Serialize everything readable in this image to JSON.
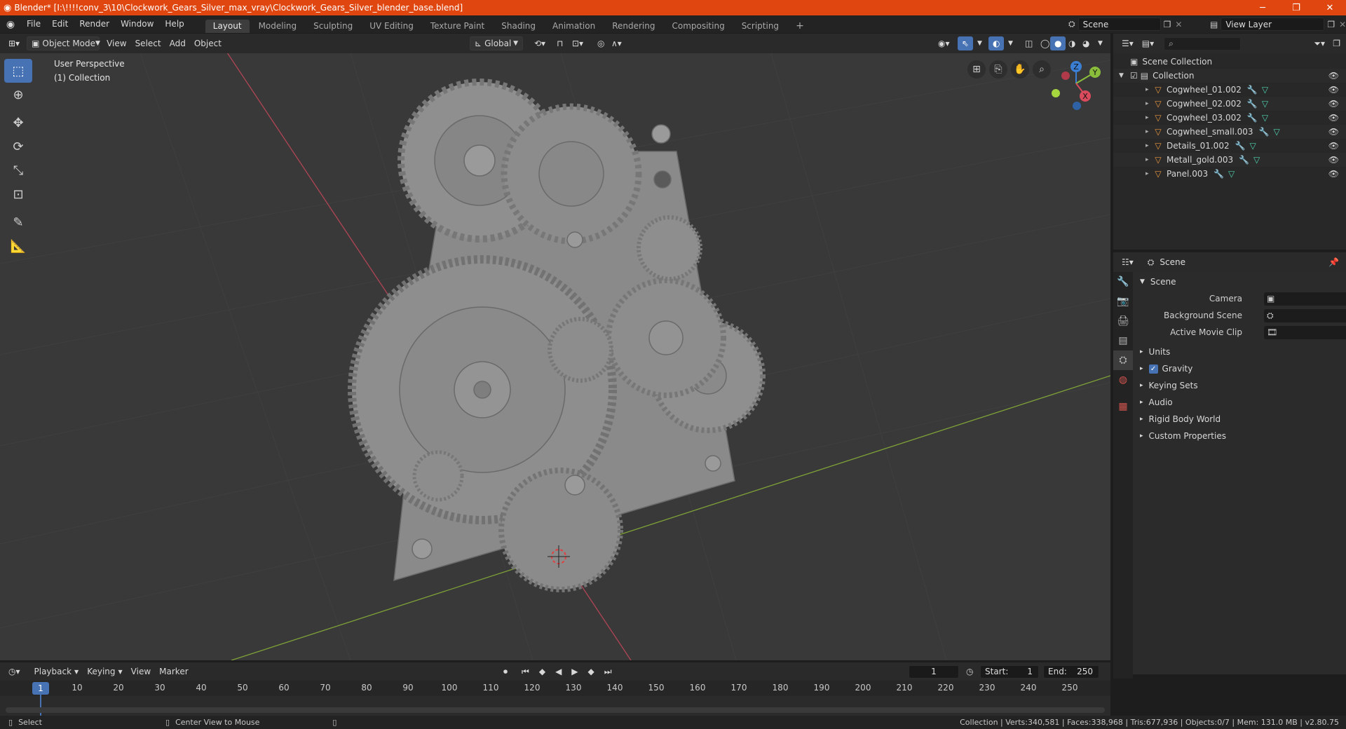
{
  "window": {
    "title": "Blender* [I:\\!!!!conv_3\\10\\Clockwork_Gears_Silver_max_vray\\Clockwork_Gears_Silver_blender_base.blend]",
    "minimize": "─",
    "maximize": "❐",
    "close": "✕"
  },
  "menu": {
    "file": "File",
    "edit": "Edit",
    "render": "Render",
    "window": "Window",
    "help": "Help"
  },
  "workspaces": [
    {
      "label": "Layout",
      "active": true
    },
    {
      "label": "Modeling"
    },
    {
      "label": "Sculpting"
    },
    {
      "label": "UV Editing"
    },
    {
      "label": "Texture Paint"
    },
    {
      "label": "Shading"
    },
    {
      "label": "Animation"
    },
    {
      "label": "Rendering"
    },
    {
      "label": "Compositing"
    },
    {
      "label": "Scripting"
    }
  ],
  "add_workspace": "+",
  "scene_selector": {
    "value": "Scene"
  },
  "view_layer_selector": {
    "value": "View Layer"
  },
  "viewport_header": {
    "mode": "Object Mode",
    "view": "View",
    "select": "Select",
    "add": "Add",
    "object": "Object",
    "orientation": "Global"
  },
  "viewport": {
    "perspective": "User Perspective",
    "collection": "(1) Collection",
    "gizmo": {
      "z": "Z",
      "y": "Y",
      "x": "X"
    }
  },
  "outliner": {
    "search_placeholder": "",
    "scene_collection": "Scene Collection",
    "collection": "Collection",
    "objects": [
      "Cogwheel_01.002",
      "Cogwheel_02.002",
      "Cogwheel_03.002",
      "Cogwheel_small.003",
      "Details_01.002",
      "Metall_gold.003",
      "Panel.003"
    ]
  },
  "properties": {
    "context": "Scene",
    "section": "Scene",
    "camera_label": "Camera",
    "background_scene_label": "Background Scene",
    "active_movie_clip_label": "Active Movie Clip",
    "panels": [
      "Units",
      "Gravity",
      "Keying Sets",
      "Audio",
      "Rigid Body World",
      "Custom Properties"
    ],
    "gravity_checked": true
  },
  "timeline_header": {
    "playback": "Playback",
    "keying": "Keying",
    "view": "View",
    "marker": "Marker",
    "current_frame": "1",
    "start_label": "Start:",
    "start_value": "1",
    "end_label": "End:",
    "end_value": "250"
  },
  "timeline": {
    "current": "1",
    "ticks": [
      "10",
      "20",
      "30",
      "40",
      "50",
      "60",
      "70",
      "80",
      "90",
      "100",
      "110",
      "120",
      "130",
      "140",
      "150",
      "160",
      "170",
      "180",
      "190",
      "200",
      "210",
      "220",
      "230",
      "240",
      "250"
    ]
  },
  "statusbar": {
    "select": "Select",
    "center_view": "Center View to Mouse",
    "stats": "Collection | Verts:340,581 | Faces:338,968 | Tris:677,936 | Objects:0/7 | Mem: 131.0 MB | v2.80.75"
  },
  "colors": {
    "titlebar": "#e0460f",
    "accent": "#4772b3",
    "x_axis": "#d94b5c",
    "y_axis": "#8bbd3c",
    "z_axis": "#3b7fd4"
  }
}
